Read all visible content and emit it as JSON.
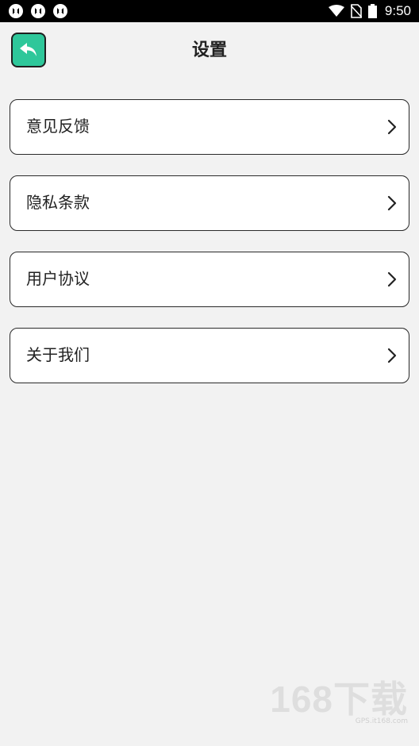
{
  "status_bar": {
    "time": "9:50",
    "left_icons": [
      "app-icon",
      "app-icon",
      "app-icon"
    ],
    "right_icons": [
      "wifi-icon",
      "no-sim-icon",
      "battery-icon"
    ]
  },
  "header": {
    "title": "设置",
    "back_icon": "reply-arrow-icon",
    "accent_color": "#2ec79a"
  },
  "menu": {
    "items": [
      {
        "label": "意见反馈",
        "icon": "chevron-right-icon"
      },
      {
        "label": "隐私条款",
        "icon": "chevron-right-icon"
      },
      {
        "label": "用户协议",
        "icon": "chevron-right-icon"
      },
      {
        "label": "关于我们",
        "icon": "chevron-right-icon"
      }
    ]
  },
  "watermark": {
    "main": "168下载",
    "sub": "GPS.it168.com"
  }
}
